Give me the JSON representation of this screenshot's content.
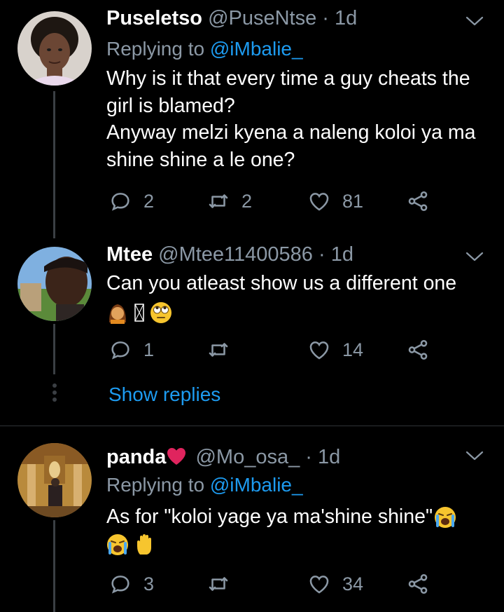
{
  "tweets": [
    {
      "name": "Puseletso",
      "handle": "@PuseNtse",
      "dot": "·",
      "time": "1d",
      "replying_label": "Replying to",
      "replying_handle": "@iMbalie_",
      "body_lines": [
        "Why is it that every time a guy cheats the girl is blamed?",
        "Anyway melzi kyena a naleng koloi ya ma shine shine a le one?"
      ],
      "replies": "2",
      "retweets": "2",
      "likes": "81"
    },
    {
      "name": "Mtee",
      "handle": "@Mtee11400586",
      "dot": "·",
      "time": "1d",
      "body_lines": [
        "Can you atleast show us a different one"
      ],
      "replies": "1",
      "retweets": "",
      "likes": "14",
      "show_replies": "Show replies"
    },
    {
      "name": "panda",
      "handle": "@Mo_osa_",
      "dot": "·",
      "time": "1d",
      "replying_label": "Replying to",
      "replying_handle": "@iMbalie_",
      "body_lines": [
        "As for \"koloi yage ya ma'shine shine\""
      ],
      "replies": "3",
      "retweets": "",
      "likes": "34"
    }
  ],
  "colors": {
    "background": "#000000",
    "text": "#ffffff",
    "muted": "#8b98a5",
    "accent": "#1d9bf0",
    "heart": "#e0245e"
  },
  "icons": [
    "reply-icon",
    "retweet-icon",
    "like-icon",
    "share-icon",
    "chevron-down-icon",
    "heart-emoji",
    "woman-emoji",
    "rolling-eyes-emoji",
    "crying-emoji",
    "raised-hand-emoji"
  ]
}
